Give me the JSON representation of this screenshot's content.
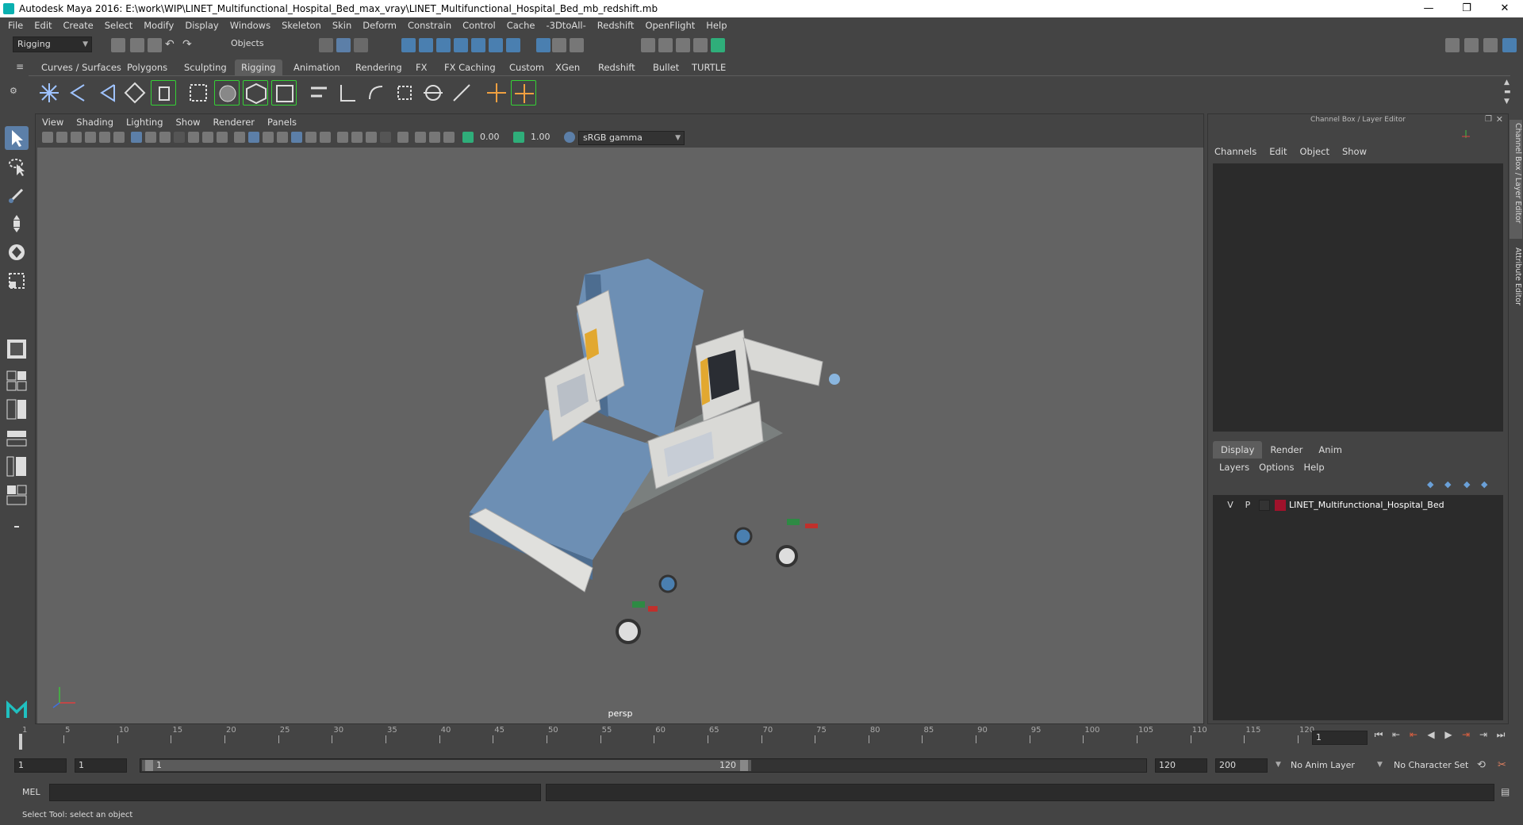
{
  "window": {
    "title": "Autodesk Maya 2016: E:\\work\\WIP\\LINET_Multifunctional_Hospital_Bed_max_vray\\LINET_Multifunctional_Hospital_Bed_mb_redshift.mb",
    "minimize": "—",
    "maximize": "❐",
    "close": "✕"
  },
  "menubar": [
    "File",
    "Edit",
    "Create",
    "Select",
    "Modify",
    "Display",
    "Windows",
    "Skeleton",
    "Skin",
    "Deform",
    "Constrain",
    "Control",
    "Cache",
    "-3DtoAll-",
    "Redshift",
    "OpenFlight",
    "Help"
  ],
  "statusline": {
    "mode": "Rigging",
    "selection_mask": "Objects"
  },
  "shelf_tabs": [
    "Curves / Surfaces",
    "Polygons",
    "Sculpting",
    "Rigging",
    "Animation",
    "Rendering",
    "FX",
    "FX Caching",
    "Custom",
    "XGen",
    "Redshift",
    "Bullet",
    "TURTLE"
  ],
  "shelf_active": "Rigging",
  "viewport": {
    "menu": [
      "View",
      "Shading",
      "Lighting",
      "Show",
      "Renderer",
      "Panels"
    ],
    "exposure": "0.00",
    "gamma": "1.00",
    "color_space": "sRGB gamma",
    "camera_label": "persp"
  },
  "channel_box": {
    "title": "Channel Box / Layer Editor",
    "menu": [
      "Channels",
      "Edit",
      "Object",
      "Show"
    ],
    "layer_tabs": [
      "Display",
      "Render",
      "Anim"
    ],
    "layer_active": "Display",
    "layer_menu": [
      "Layers",
      "Options",
      "Help"
    ],
    "layers": [
      {
        "visible": "V",
        "playback": "P",
        "name": "LINET_Multifunctional_Hospital_Bed",
        "color": "#a0122b"
      }
    ]
  },
  "side_tabs": [
    "Channel Box / Layer Editor",
    "Attribute Editor"
  ],
  "timeslider": {
    "ticks": [
      1,
      5,
      10,
      15,
      20,
      25,
      30,
      35,
      40,
      45,
      50,
      55,
      60,
      65,
      70,
      75,
      80,
      85,
      90,
      95,
      100,
      105,
      110,
      115,
      120
    ],
    "current_frame": "1"
  },
  "range": {
    "start": "1",
    "playback_start": "1",
    "slider_start": "1",
    "slider_end": "120",
    "playback_end": "120",
    "end": "200",
    "anim_layer": "No Anim Layer",
    "character_set": "No Character Set"
  },
  "cmdline": {
    "label": "MEL"
  },
  "helpline": {
    "text": "Select Tool: select an object"
  }
}
